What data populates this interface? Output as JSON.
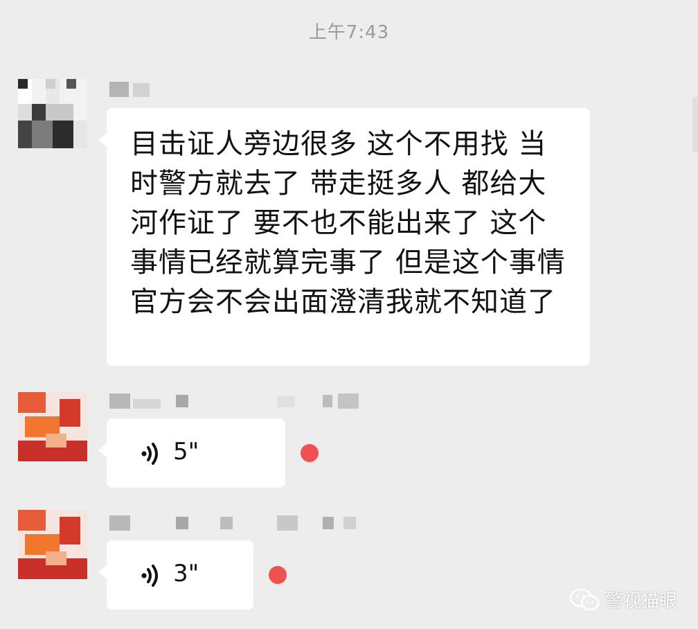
{
  "chat": {
    "timestamp": "上午7:43",
    "messages": [
      {
        "type": "text",
        "text": "目击证人旁边很多  这个不用找  当时警方就去了  带走挺多人  都给大河作证了  要不也不能出来了  这个事情已经就算完事了  但是这个事情官方会不会出面澄清我就不知道了"
      },
      {
        "type": "voice",
        "duration": "5\"",
        "unread": true
      },
      {
        "type": "voice",
        "duration": "3\"",
        "unread": true
      }
    ]
  },
  "icons": {
    "voice": "voice-wave-icon",
    "watermark": "wechat-icon"
  },
  "colors": {
    "background": "#ededed",
    "bubble": "#ffffff",
    "unread_dot": "#f05050",
    "timestamp": "#9a9a9a"
  },
  "watermark": {
    "text": "警视猫眼"
  }
}
